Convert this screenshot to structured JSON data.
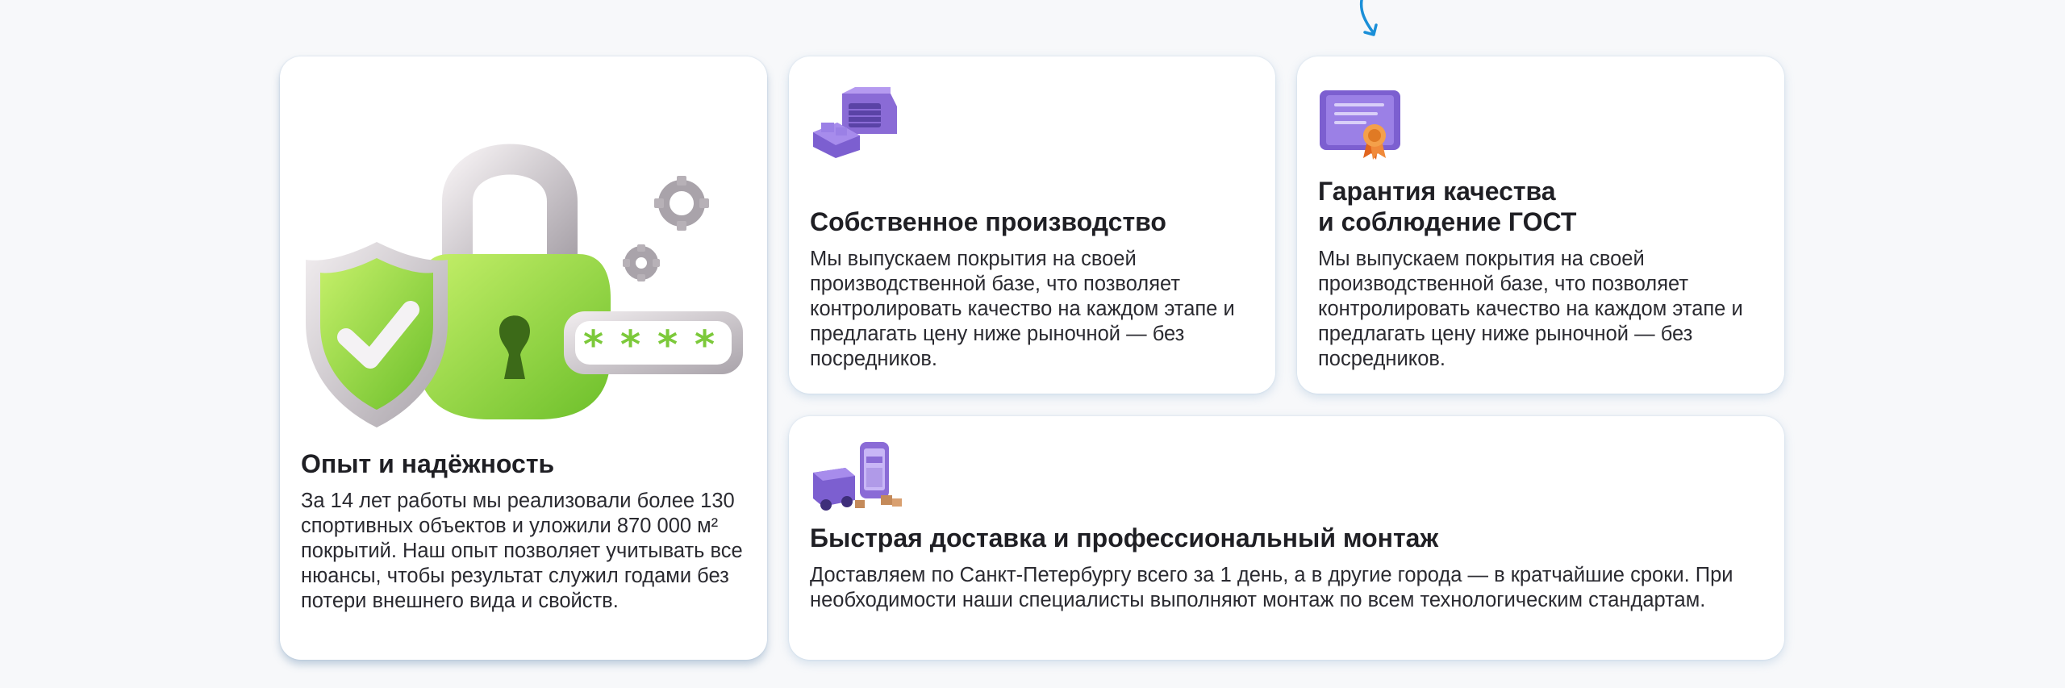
{
  "cards": {
    "experience": {
      "title": "Опыт и надёжность",
      "text": "За 14 лет работы мы реализовали более 130 спортивных объектов и уложили 870 000 м² покрытий. Наш опыт позволяет учитывать все нюансы, чтобы результат служил годами без потери внешнего вида и свойств.",
      "icon": "padlock-shield-icon"
    },
    "production": {
      "title": "Собственное производство",
      "text": "Мы выпускаем покрытия на своей производственной базе, что позволяет контролировать качество на каждом этапе и предлагать цену ниже рыночной — без посредников.",
      "icon": "factory-icon"
    },
    "quality": {
      "title": "Гарантия качества\nи соблюдение ГОСТ",
      "text": "Мы выпускаем покрытия на своей производственной базе, что позволяет контролировать качество на каждом этапе и предлагать цену ниже рыночной — без посредников.",
      "icon": "certificate-icon"
    },
    "delivery": {
      "title": "Быстрая доставка и профессиональный монтаж",
      "text": "Доставляем по Санкт-Петербургу всего за 1 день, а в другие города — в кратчайшие сроки. При необходимости наши специалисты выполняют монтаж по всем технологическим стандартам.",
      "icon": "delivery-truck-icon"
    }
  },
  "colors": {
    "background": "#f7f8fa",
    "card": "#ffffff",
    "accent_green": "#8fd43a",
    "accent_purple": "#8a6bd6",
    "arrow_blue": "#1a8fd8"
  }
}
